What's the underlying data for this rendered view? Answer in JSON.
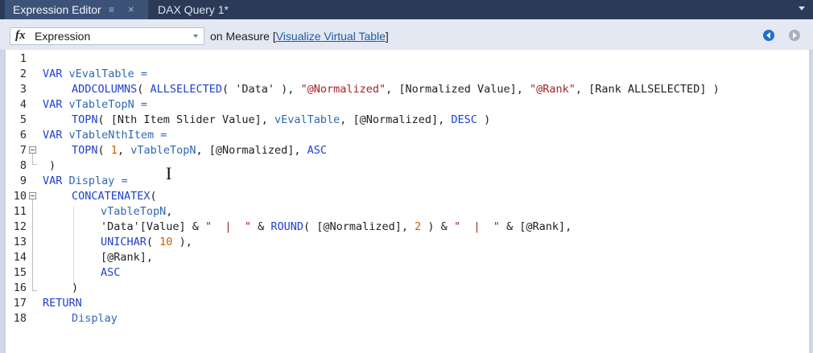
{
  "tabs": [
    {
      "label": "Expression Editor",
      "pin": "≡",
      "close": "×"
    },
    {
      "label": "DAX Query 1*"
    }
  ],
  "toolbar": {
    "fx": "fx",
    "expression_value": "Expression",
    "context_label": "on Measure ",
    "measure_link_prefix": "[",
    "measure_link": "Visualize Virtual Table",
    "measure_link_suffix": "]"
  },
  "code": {
    "line_numbers": [
      "1",
      "2",
      "3",
      "4",
      "5",
      "6",
      "7",
      "8",
      "9",
      "10",
      "11",
      "12",
      "13",
      "14",
      "15",
      "16",
      "17",
      "18"
    ],
    "l2": {
      "kw": "VAR",
      "rest": " vEvalTable ="
    },
    "l3": {
      "fn": "ADDCOLUMNS",
      "a": "( ",
      "fn2": "ALLSELECTED",
      "b": "( 'Data' ), ",
      "s1": "\"@Normalized\"",
      "c": ", [Normalized Value], ",
      "s2": "\"@Rank\"",
      "d": ", [Rank ALLSELECTED] )"
    },
    "l4": {
      "kw": "VAR",
      "rest": " vTableTopN ="
    },
    "l5": {
      "fn": "TOPN",
      "a": "( [Nth Item Slider Value], ",
      "v": "vEvalTable",
      "b": ", [@Normalized], ",
      "kw": "DESC",
      "c": " )"
    },
    "l6": {
      "kw": "VAR",
      "rest": " vTableNthItem ="
    },
    "l7": {
      "fn": "TOPN",
      "a": "( ",
      "n": "1",
      "b": ", ",
      "v": "vTableTopN",
      "c": ", [@Normalized], ",
      "kw": "ASC"
    },
    "l8": {
      "text": ")"
    },
    "l9": {
      "kw": "VAR",
      "rest": " Display ="
    },
    "l10": {
      "fn": "CONCATENATEX",
      "a": "("
    },
    "l11": {
      "v": "vTableTopN",
      "a": ","
    },
    "l12": {
      "a": "'Data'[Value] & ",
      "s1": "\"  |  \"",
      "b": " & ",
      "fn": "ROUND",
      "c": "( [@Normalized], ",
      "n": "2",
      "d": " ) & ",
      "s2": "\"  |  \"",
      "e": " & [@Rank],"
    },
    "l13": {
      "fn": "UNICHAR",
      "a": "( ",
      "n": "10",
      "b": " ),"
    },
    "l14": {
      "text": "[@Rank],"
    },
    "l15": {
      "kw": "ASC"
    },
    "l16": {
      "text": ")"
    },
    "l17": {
      "kw": "RETURN"
    },
    "l18": {
      "v": "Display"
    }
  },
  "cursor": "I"
}
